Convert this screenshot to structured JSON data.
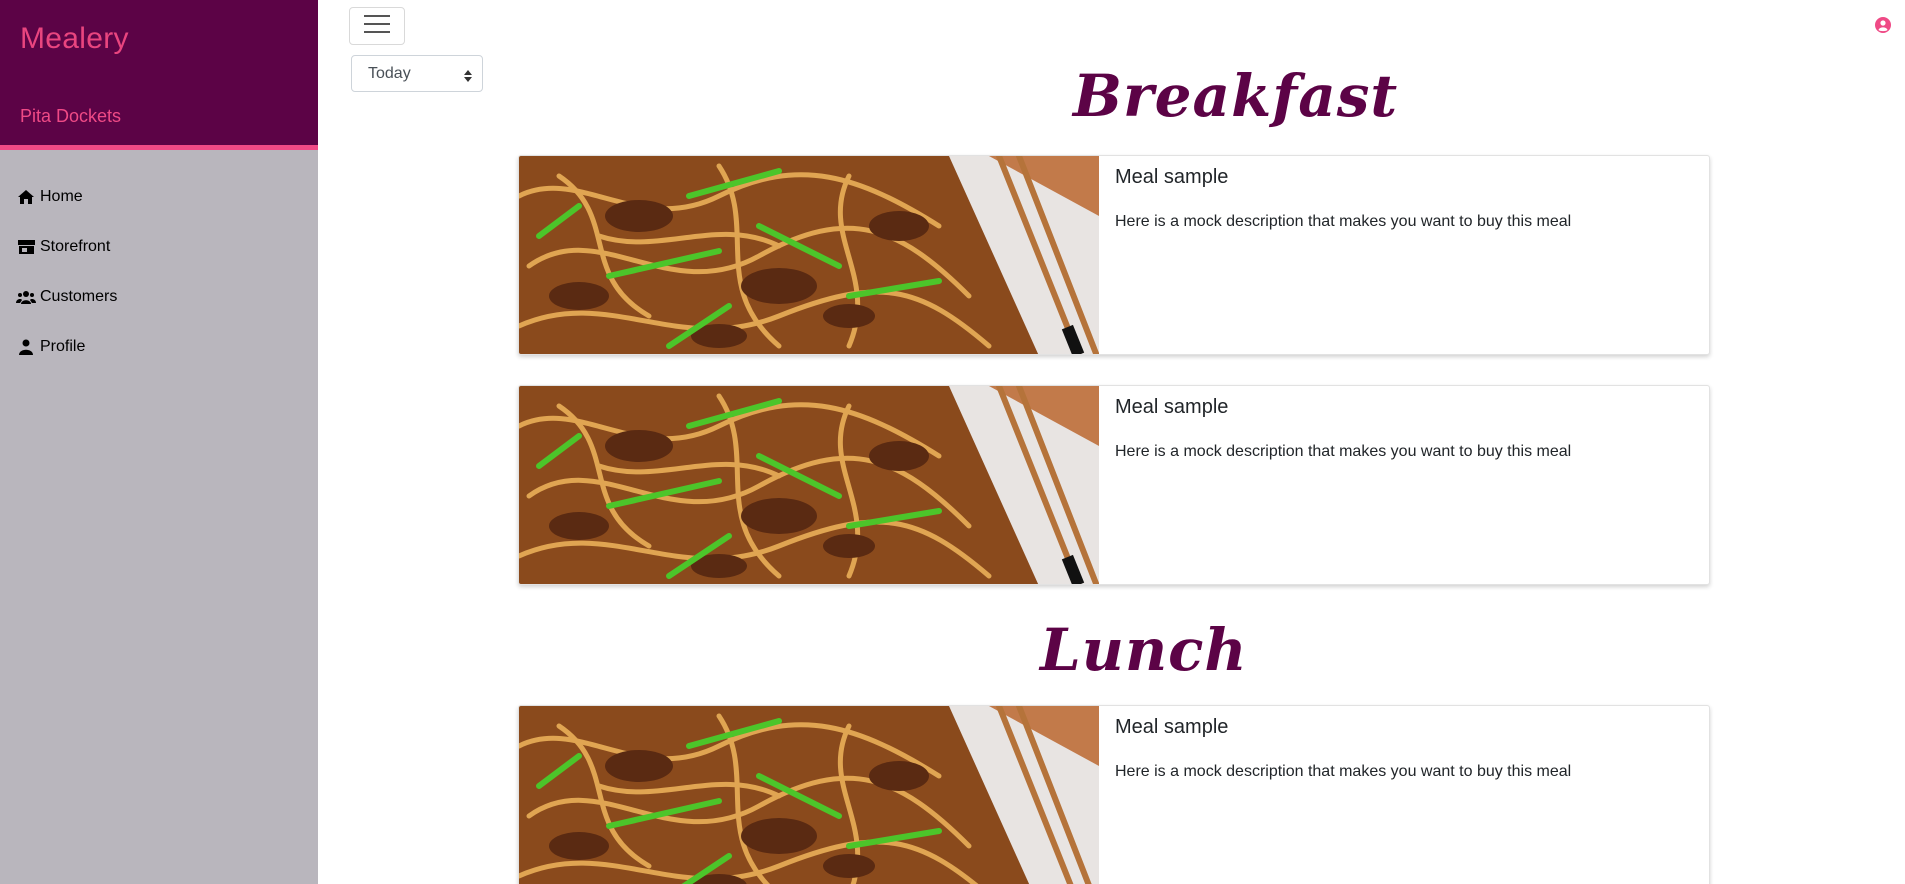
{
  "brand": "Mealery",
  "store_name": "Pita Dockets",
  "nav": [
    {
      "label": "Home",
      "icon": "home-icon"
    },
    {
      "label": "Storefront",
      "icon": "store-icon"
    },
    {
      "label": "Customers",
      "icon": "users-icon"
    },
    {
      "label": "Profile",
      "icon": "user-icon"
    }
  ],
  "topbar": {
    "menu_icon": "hamburger-menu-icon",
    "day_select": {
      "selected": "Today"
    },
    "account_icon": "user-circle-icon"
  },
  "sections": [
    {
      "title": "Breakfast",
      "meals": [
        {
          "title": "Meal sample",
          "description": "Here is a mock description that makes you want to buy this meal"
        },
        {
          "title": "Meal sample",
          "description": "Here is a mock description that makes you want to buy this meal"
        }
      ]
    },
    {
      "title": "Lunch",
      "meals": [
        {
          "title": "Meal sample",
          "description": "Here is a mock description that makes you want to buy this meal"
        }
      ]
    }
  ],
  "colors": {
    "sidebar_header": "#5c0346",
    "accent": "#ef4a86",
    "sidebar_bg": "#b9b6bd",
    "heading": "#5c0346"
  }
}
